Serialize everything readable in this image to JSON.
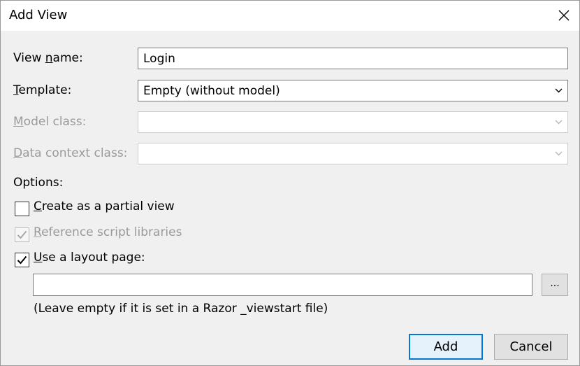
{
  "window": {
    "title": "Add View"
  },
  "form": {
    "view_name": {
      "label_pre": "View ",
      "label_key": "n",
      "label_post": "ame:",
      "value": "Login"
    },
    "template": {
      "label_pre": "",
      "label_key": "T",
      "label_post": "emplate:",
      "value": "Empty (without model)"
    },
    "model_class": {
      "label_pre": "",
      "label_key": "M",
      "label_post": "odel class:",
      "value": ""
    },
    "data_context": {
      "label_pre": "",
      "label_key": "D",
      "label_post": "ata context class:",
      "value": ""
    }
  },
  "options": {
    "heading": "Options:",
    "partial_view": {
      "key": "C",
      "label": "reate as a partial view",
      "checked": false
    },
    "reference_scripts": {
      "key": "R",
      "label": "eference script libraries",
      "checked": true,
      "disabled": true
    },
    "layout_page": {
      "key": "U",
      "label": "se a layout page:",
      "checked": true
    },
    "layout_path": "",
    "browse_label": "...",
    "hint": "(Leave empty if it is set in a Razor _viewstart file)"
  },
  "buttons": {
    "add": "Add",
    "cancel": "Cancel"
  },
  "colors": {
    "accent": "#0078d7",
    "disabled_text": "#9a9a9a"
  }
}
